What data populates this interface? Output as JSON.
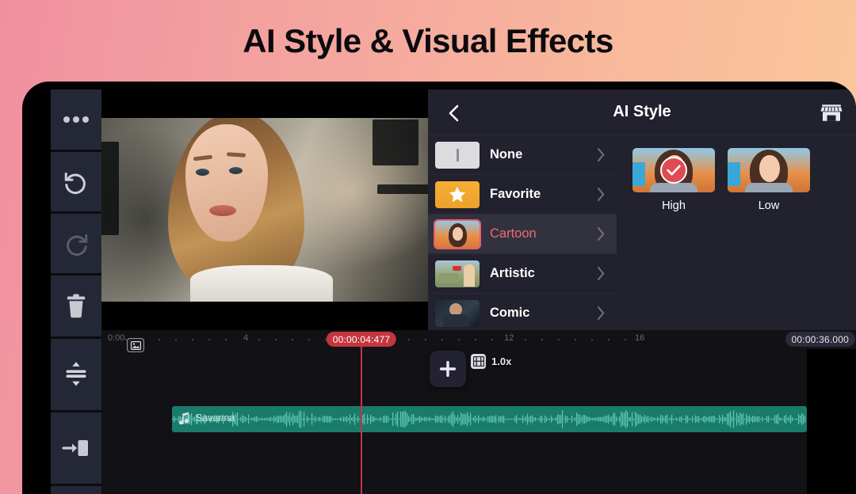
{
  "headline": "AI Style & Visual Effects",
  "colors": {
    "accent_red": "#ef6a72",
    "playhead_red": "#c4353e",
    "panel_bg": "#22222e",
    "audio_teal": "#1b7b6b",
    "favorite_orange": "#f5ae35"
  },
  "left_toolbar": {
    "items": [
      {
        "name": "more-options",
        "icon": "ellipsis-icon"
      },
      {
        "name": "undo",
        "icon": "undo-icon"
      },
      {
        "name": "redo",
        "icon": "redo-icon"
      },
      {
        "name": "delete",
        "icon": "trash-icon"
      },
      {
        "name": "expand-tracks",
        "icon": "expand-vertical-icon"
      },
      {
        "name": "insert-clip",
        "icon": "insert-right-icon"
      }
    ]
  },
  "panel": {
    "title": "AI Style",
    "back_icon": "chevron-left-icon",
    "store_icon": "store-icon",
    "styles": [
      {
        "label": "None",
        "thumb": "none-bar",
        "selected": false
      },
      {
        "label": "Favorite",
        "thumb": "star",
        "selected": false
      },
      {
        "label": "Cartoon",
        "thumb": "cartoon-photo",
        "selected": true
      },
      {
        "label": "Artistic",
        "thumb": "artistic-photo",
        "selected": false
      },
      {
        "label": "Comic",
        "thumb": "comic-photo",
        "selected": false
      }
    ],
    "variants": [
      {
        "label": "High",
        "selected": true
      },
      {
        "label": "Low",
        "selected": false
      }
    ]
  },
  "timeline": {
    "ruler_labels": [
      "0:00",
      "4",
      "12",
      "16"
    ],
    "playhead_time": "00:00:04:477",
    "duration": "00:00:36.000",
    "clip_badge_icon": "image-icon",
    "add_button_label": "+",
    "speed_icon": "film-icon",
    "speed_label": "1.0x",
    "audio": {
      "icon": "music-note-icon",
      "name": "Savanna"
    }
  }
}
